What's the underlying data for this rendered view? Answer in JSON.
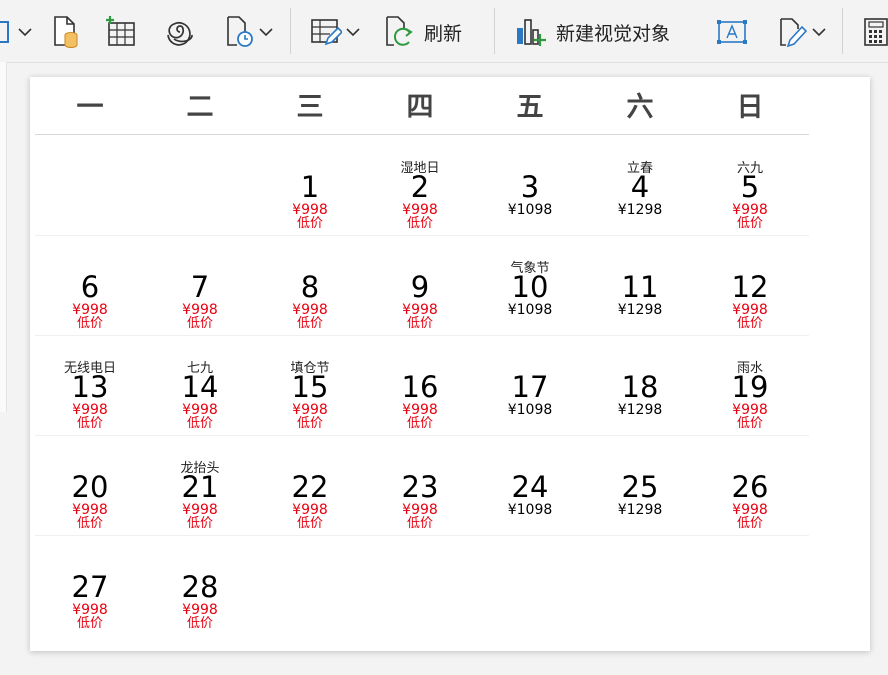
{
  "toolbar": {
    "refresh_label": "刷新",
    "new_visual_label": "新建视觉对象"
  },
  "weekdays": [
    "一",
    "二",
    "三",
    "四",
    "五",
    "六",
    "日"
  ],
  "weeks": [
    [
      null,
      null,
      {
        "day": "1",
        "festival": "",
        "price": "¥998",
        "note": "低价",
        "low": true
      },
      {
        "day": "2",
        "festival": "湿地日",
        "price": "¥998",
        "note": "低价",
        "low": true
      },
      {
        "day": "3",
        "festival": "",
        "price": "¥1098",
        "note": "",
        "low": false
      },
      {
        "day": "4",
        "festival": "立春",
        "price": "¥1298",
        "note": "",
        "low": false
      },
      {
        "day": "5",
        "festival": "六九",
        "price": "¥998",
        "note": "低价",
        "low": true
      }
    ],
    [
      {
        "day": "6",
        "festival": "",
        "price": "¥998",
        "note": "低价",
        "low": true
      },
      {
        "day": "7",
        "festival": "",
        "price": "¥998",
        "note": "低价",
        "low": true
      },
      {
        "day": "8",
        "festival": "",
        "price": "¥998",
        "note": "低价",
        "low": true
      },
      {
        "day": "9",
        "festival": "",
        "price": "¥998",
        "note": "低价",
        "low": true
      },
      {
        "day": "10",
        "festival": "气象节",
        "price": "¥1098",
        "note": "",
        "low": false
      },
      {
        "day": "11",
        "festival": "",
        "price": "¥1298",
        "note": "",
        "low": false
      },
      {
        "day": "12",
        "festival": "",
        "price": "¥998",
        "note": "低价",
        "low": true
      }
    ],
    [
      {
        "day": "13",
        "festival": "无线电日",
        "price": "¥998",
        "note": "低价",
        "low": true
      },
      {
        "day": "14",
        "festival": "七九",
        "price": "¥998",
        "note": "低价",
        "low": true
      },
      {
        "day": "15",
        "festival": "填仓节",
        "price": "¥998",
        "note": "低价",
        "low": true
      },
      {
        "day": "16",
        "festival": "",
        "price": "¥998",
        "note": "低价",
        "low": true
      },
      {
        "day": "17",
        "festival": "",
        "price": "¥1098",
        "note": "",
        "low": false
      },
      {
        "day": "18",
        "festival": "",
        "price": "¥1298",
        "note": "",
        "low": false
      },
      {
        "day": "19",
        "festival": "雨水",
        "price": "¥998",
        "note": "低价",
        "low": true
      }
    ],
    [
      {
        "day": "20",
        "festival": "",
        "price": "¥998",
        "note": "低价",
        "low": true
      },
      {
        "day": "21",
        "festival": "龙抬头",
        "price": "¥998",
        "note": "低价",
        "low": true
      },
      {
        "day": "22",
        "festival": "",
        "price": "¥998",
        "note": "低价",
        "low": true
      },
      {
        "day": "23",
        "festival": "",
        "price": "¥998",
        "note": "低价",
        "low": true
      },
      {
        "day": "24",
        "festival": "",
        "price": "¥1098",
        "note": "",
        "low": false
      },
      {
        "day": "25",
        "festival": "",
        "price": "¥1298",
        "note": "",
        "low": false
      },
      {
        "day": "26",
        "festival": "",
        "price": "¥998",
        "note": "低价",
        "low": true
      }
    ],
    [
      {
        "day": "27",
        "festival": "",
        "price": "¥998",
        "note": "低价",
        "low": true
      },
      {
        "day": "28",
        "festival": "",
        "price": "¥998",
        "note": "低价",
        "low": true
      },
      null,
      null,
      null,
      null,
      null
    ]
  ],
  "colors": {
    "low_price": "#e8000f",
    "accent_blue": "#2b78c5",
    "accent_green": "#2e9a3f",
    "accent_orange": "#e8a33a"
  },
  "icons": [
    "table-partial-icon",
    "cylinder-doc-icon",
    "add-table-icon",
    "spiral-icon",
    "schedule-doc-icon",
    "edit-table-icon",
    "refresh-icon",
    "new-visual-icon",
    "text-box-icon",
    "edit-pen-icon",
    "calculator-icon"
  ]
}
